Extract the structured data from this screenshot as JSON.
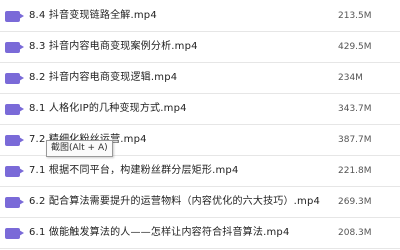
{
  "files": [
    {
      "name": "8.4 抖音变现链路全解.mp4",
      "size": "213.5M"
    },
    {
      "name": "8.3 抖音内容电商变现案例分析.mp4",
      "size": "429.5M"
    },
    {
      "name": "8.2 抖音内容电商变现逻辑.mp4",
      "size": "234M"
    },
    {
      "name": "8.1 人格化IP的几种变现方式.mp4",
      "size": "343.7M"
    },
    {
      "name": "7.2 精细化粉丝运营.mp4",
      "size": "387.7M"
    },
    {
      "name": "7.1 根据不同平台，构建粉丝群分层矩形.mp4",
      "size": "221.8M"
    },
    {
      "name": "6.2 配合算法需要提升的运营物料（内容优化的六大技巧）.mp4",
      "size": "269.3M"
    },
    {
      "name": "6.1 做能触发算法的人——怎样让内容符合抖音算法.mp4",
      "size": "208.3M"
    }
  ],
  "tooltip": {
    "text": "截图(Alt + A)"
  },
  "colors": {
    "file_icon": "#7a6ad8",
    "divider": "#e6e6e6"
  },
  "icons": {
    "file": "video-file-icon"
  }
}
